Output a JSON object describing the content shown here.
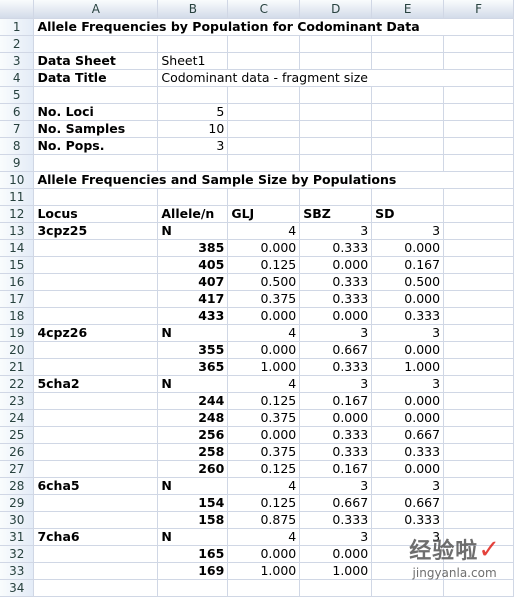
{
  "columns": [
    "A",
    "B",
    "C",
    "D",
    "E",
    "F"
  ],
  "title": "Allele Frequencies by Population for Codominant Data",
  "meta": {
    "data_sheet_label": "Data Sheet",
    "data_sheet_value": "Sheet1",
    "data_title_label": "Data Title",
    "data_title_value": "Codominant data - fragment size",
    "no_loci_label": "No. Loci",
    "no_loci_value": "5",
    "no_samples_label": "No. Samples",
    "no_samples_value": "10",
    "no_pops_label": "No. Pops.",
    "no_pops_value": "3"
  },
  "section_title": "Allele Frequencies and Sample Size by Populations",
  "headers": [
    "Locus",
    "Allele/n",
    "GLJ",
    "SBZ",
    "SD"
  ],
  "rows": [
    [
      "3cpz25",
      "N",
      "4",
      "3",
      "3"
    ],
    [
      "",
      "385",
      "0.000",
      "0.333",
      "0.000"
    ],
    [
      "",
      "405",
      "0.125",
      "0.000",
      "0.167"
    ],
    [
      "",
      "407",
      "0.500",
      "0.333",
      "0.500"
    ],
    [
      "",
      "417",
      "0.375",
      "0.333",
      "0.000"
    ],
    [
      "",
      "433",
      "0.000",
      "0.000",
      "0.333"
    ],
    [
      "4cpz26",
      "N",
      "4",
      "3",
      "3"
    ],
    [
      "",
      "355",
      "0.000",
      "0.667",
      "0.000"
    ],
    [
      "",
      "365",
      "1.000",
      "0.333",
      "1.000"
    ],
    [
      "5cha2",
      "N",
      "4",
      "3",
      "3"
    ],
    [
      "",
      "244",
      "0.125",
      "0.167",
      "0.000"
    ],
    [
      "",
      "248",
      "0.375",
      "0.000",
      "0.000"
    ],
    [
      "",
      "256",
      "0.000",
      "0.333",
      "0.667"
    ],
    [
      "",
      "258",
      "0.375",
      "0.333",
      "0.333"
    ],
    [
      "",
      "260",
      "0.125",
      "0.167",
      "0.000"
    ],
    [
      "6cha5",
      "N",
      "4",
      "3",
      "3"
    ],
    [
      "",
      "154",
      "0.125",
      "0.667",
      "0.667"
    ],
    [
      "",
      "158",
      "0.875",
      "0.333",
      "0.333"
    ],
    [
      "7cha6",
      "N",
      "4",
      "3",
      "3"
    ],
    [
      "",
      "165",
      "0.000",
      "0.000",
      ""
    ],
    [
      "",
      "169",
      "1.000",
      "1.000",
      ""
    ]
  ],
  "watermark": {
    "line1": "经验啦",
    "line2": "jingyanla.com"
  }
}
